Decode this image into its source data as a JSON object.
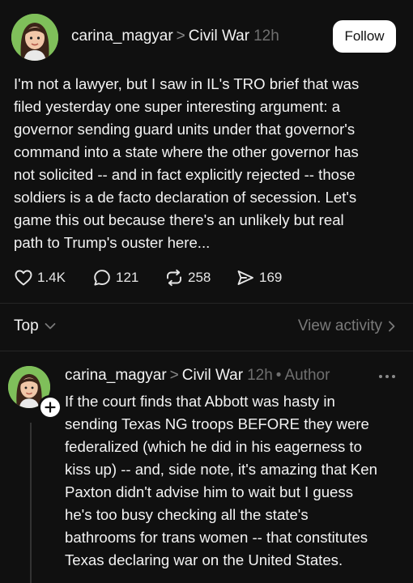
{
  "post": {
    "avatar_icon": "avatar-woman-cartoon",
    "username": "carina_magyar",
    "separator": ">",
    "community": "Civil War",
    "timestamp": "12h",
    "follow_label": "Follow",
    "body_lines": [
      "I'm not a lawyer, but I saw in IL's TRO brief that was",
      "filed yesterday one super interesting argument: a",
      "governor sending guard units under that governor's",
      "command into a state where the other governor has",
      "not solicited -- and in fact explicitly rejected -- those",
      "soldiers is a de facto declaration of secession. Let's",
      "game this out because there's an unlikely but real",
      "path to Trump's ouster here..."
    ],
    "actions": {
      "likes": "1.4K",
      "replies": "121",
      "reposts": "258",
      "shares": "169"
    }
  },
  "sort_bar": {
    "sort_label": "Top",
    "view_activity_label": "View activity"
  },
  "reply": {
    "avatar_icon": "avatar-woman-cartoon",
    "username": "carina_magyar",
    "separator": ">",
    "community": "Civil War",
    "timestamp": "12h",
    "dot": "•",
    "author_tag": "Author",
    "body_lines": [
      "If the court finds that Abbott was hasty in",
      "sending Texas NG troops BEFORE they were",
      "federalized (which he did in his eagerness to",
      "kiss up) -- and, side note, it's amazing that Ken",
      "Paxton didn't advise him to wait but I guess",
      "he's too busy checking all the state's",
      "bathrooms for trans women -- that constitutes",
      "Texas declaring war on the United States."
    ]
  },
  "colors": {
    "background": "#101010",
    "text": "#f3f3f3",
    "muted": "#6f6f6f",
    "avatar_bg": "#7fbf5a",
    "follow_bg": "#ffffff"
  }
}
